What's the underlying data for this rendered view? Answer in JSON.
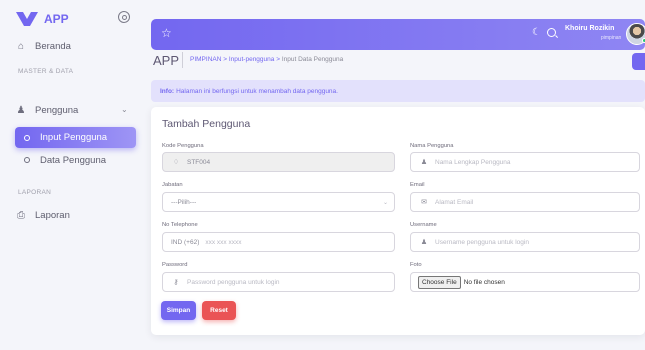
{
  "brand": {
    "name": "APP"
  },
  "sidebar": {
    "items": [
      {
        "label": "Beranda",
        "icon": "home-icon"
      },
      {
        "label": "Pengguna",
        "icon": "users-icon"
      },
      {
        "label": "Laporan",
        "icon": "printer-icon"
      }
    ],
    "sections": [
      "MASTER & DATA",
      "LAPORAN"
    ],
    "sub_items": [
      {
        "label": "Input Pengguna",
        "active": true
      },
      {
        "label": "Data Pengguna",
        "active": false
      }
    ]
  },
  "header": {
    "user_name": "Khoiru Rozikin",
    "user_role": "pimpinan"
  },
  "breadcrumb": {
    "title": "APP",
    "path": [
      "PIMPINAN",
      "Input-pengguna",
      "Input Data Pengguna"
    ]
  },
  "info": {
    "label": "Info:",
    "text": "Halaman ini berfungsi untuk menambah data pengguna."
  },
  "form": {
    "title": "Tambah Pengguna",
    "kode_label": "Kode Pengguna",
    "kode_value": "STF004",
    "nama_label": "Nama Pengguna",
    "nama_placeholder": "Nama Lengkap Pengguna",
    "jabatan_label": "Jabatan",
    "jabatan_value": "---Pilih---",
    "email_label": "Email",
    "email_placeholder": "Alamat Email",
    "telp_label": "No Telephone",
    "telp_prefix": "IND (+62)",
    "telp_placeholder": "xxx xxx xxxx",
    "username_label": "Username",
    "username_placeholder": "Username pengguna untuk login",
    "password_label": "Password",
    "password_placeholder": "Password pengguna untuk login",
    "foto_label": "Foto",
    "file_button": "Choose File",
    "file_status": "No file chosen",
    "save_label": "Simpan",
    "reset_label": "Reset"
  },
  "colors": {
    "primary": "#7367f0",
    "danger": "#ea5455"
  }
}
